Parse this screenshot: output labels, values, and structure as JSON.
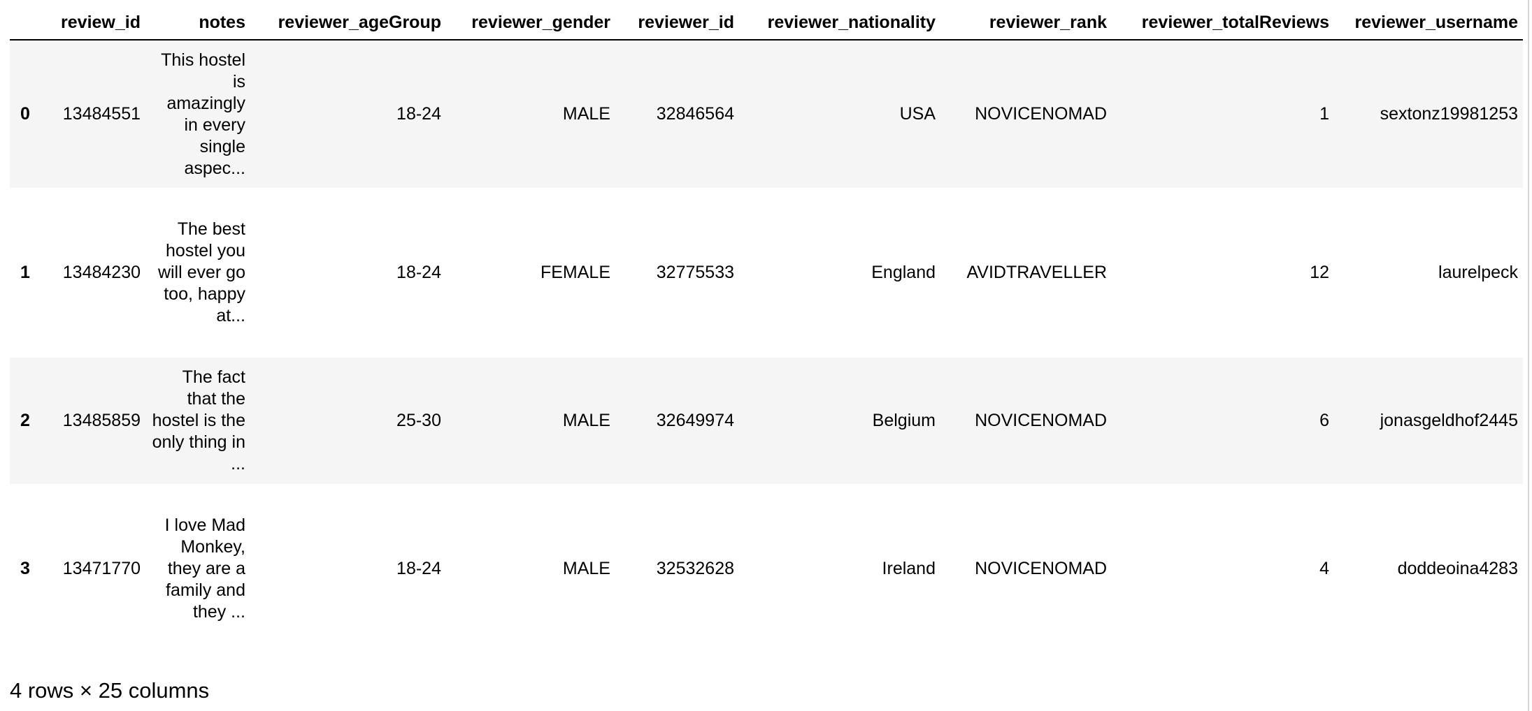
{
  "table": {
    "columns": [
      "",
      "review_id",
      "notes",
      "reviewer_ageGroup",
      "reviewer_gender",
      "reviewer_id",
      "reviewer_nationality",
      "reviewer_rank",
      "reviewer_totalReviews",
      "reviewer_username"
    ],
    "rows": [
      {
        "index": "0",
        "review_id": "13484551",
        "notes": "This hostel is amazingly in every single aspec...",
        "reviewer_ageGroup": "18-24",
        "reviewer_gender": "MALE",
        "reviewer_id": "32846564",
        "reviewer_nationality": "USA",
        "reviewer_rank": "NOVICENOMAD",
        "reviewer_totalReviews": "1",
        "reviewer_username": "sextonz19981253"
      },
      {
        "index": "1",
        "review_id": "13484230",
        "notes": "The best hostel you will ever go too, happy at...",
        "reviewer_ageGroup": "18-24",
        "reviewer_gender": "FEMALE",
        "reviewer_id": "32775533",
        "reviewer_nationality": "England",
        "reviewer_rank": "AVIDTRAVELLER",
        "reviewer_totalReviews": "12",
        "reviewer_username": "laurelpeck"
      },
      {
        "index": "2",
        "review_id": "13485859",
        "notes": "The fact that the hostel is the only thing in ...",
        "reviewer_ageGroup": "25-30",
        "reviewer_gender": "MALE",
        "reviewer_id": "32649974",
        "reviewer_nationality": "Belgium",
        "reviewer_rank": "NOVICENOMAD",
        "reviewer_totalReviews": "6",
        "reviewer_username": "jonasgeldhof2445"
      },
      {
        "index": "3",
        "review_id": "13471770",
        "notes": "I love Mad Monkey, they are a family and they ...",
        "reviewer_ageGroup": "18-24",
        "reviewer_gender": "MALE",
        "reviewer_id": "32532628",
        "reviewer_nationality": "Ireland",
        "reviewer_rank": "NOVICENOMAD",
        "reviewer_totalReviews": "4",
        "reviewer_username": "doddeoina4283"
      }
    ]
  },
  "summary": "4 rows × 25 columns"
}
